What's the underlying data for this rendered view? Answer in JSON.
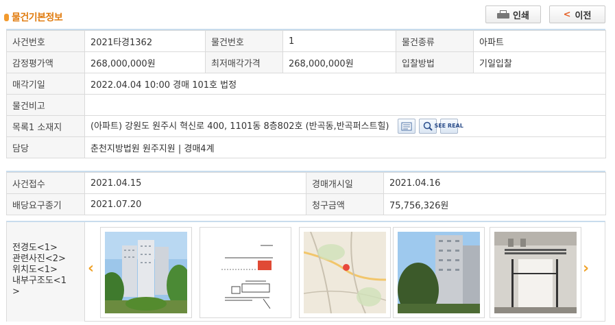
{
  "title": "물건기본정보",
  "buttons": {
    "print": "인쇄",
    "back": "이전",
    "back_chevron": "<"
  },
  "basic": {
    "case_no_label": "사건번호",
    "case_no": "2021타경1362",
    "item_no_label": "물건번호",
    "item_no": "1",
    "item_type_label": "물건종류",
    "item_type": "아파트",
    "appraisal_label": "감정평가액",
    "appraisal": "268,000,000원",
    "min_price_label": "최저매각가격",
    "min_price": "268,000,000원",
    "bid_method_label": "입찰방법",
    "bid_method": "기일입찰",
    "sale_date_label": "매각기일",
    "sale_date": "2022.04.04 10:00 경매 101호 법정",
    "remarks_label": "물건비고",
    "remarks": "",
    "address_label": "목록1 소재지",
    "address": "(아파트) 강원도 원주시 혁신로 400, 1101동 8층802호 (반곡동,반곡퍼스트힐)",
    "address_icons": [
      "document-icon",
      "magnifier-map-icon",
      "see-real-icon"
    ],
    "see_real_text": "SEE REAL",
    "charge_label": "담당",
    "charge": "춘천지방법원 원주지원 | 경매4계"
  },
  "dates": {
    "receipt_label": "사건접수",
    "receipt": "2021.04.15",
    "start_label": "경매개시일",
    "start": "2021.04.16",
    "deadline_label": "배당요구종기",
    "deadline": "2021.07.20",
    "claim_label": "청구금액",
    "claim": "75,756,326원"
  },
  "photos": {
    "labels": [
      "전경도<1>",
      "관련사진<2>",
      "위치도<1>",
      "내부구조도<1",
      ">"
    ],
    "prev": "‹",
    "next": "›",
    "thumbs": [
      "apartment-front-photo",
      "floor-plan-drawing",
      "location-map",
      "apartment-building-photo",
      "stairwell-photo"
    ]
  },
  "colors": {
    "accent": "#e07c10",
    "arrow": "#f0a32a",
    "header_line": "#c8dced",
    "label_bg": "#f6f6f6"
  }
}
